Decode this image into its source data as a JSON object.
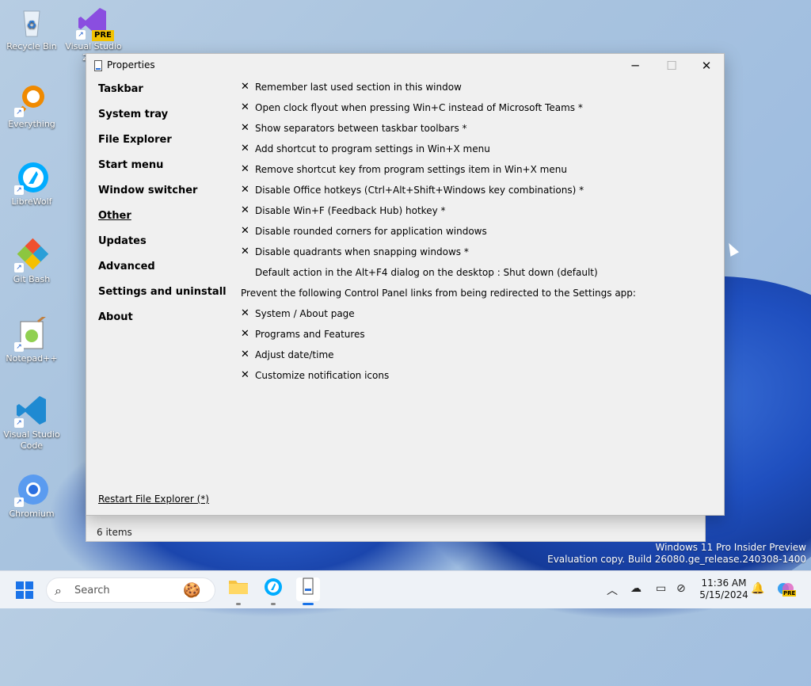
{
  "desktop": {
    "icons": [
      {
        "label": "Recycle Bin"
      },
      {
        "label": "Visual Studio 2022",
        "badge": "PRE"
      },
      {
        "label": "Everything"
      },
      {
        "label": "LibreWolf"
      },
      {
        "label": "Git Bash"
      },
      {
        "label": "Notepad++"
      },
      {
        "label": "Visual Studio Code"
      },
      {
        "label": "Chromium"
      }
    ],
    "watermark": {
      "line1": "Windows 11 Pro Insider Preview",
      "line2": "Evaluation copy. Build 26080.ge_release.240308-1400"
    }
  },
  "back_window": {
    "status": "6 items"
  },
  "window": {
    "title": "Properties",
    "nav": [
      {
        "label": "Taskbar"
      },
      {
        "label": "System tray"
      },
      {
        "label": "File Explorer"
      },
      {
        "label": "Start menu"
      },
      {
        "label": "Window switcher"
      },
      {
        "label": "Other",
        "active": true
      },
      {
        "label": "Updates"
      },
      {
        "label": "Advanced"
      },
      {
        "label": "Settings and uninstall"
      },
      {
        "label": "About"
      }
    ],
    "check_mark": "✕",
    "options": [
      {
        "label": "Remember last used section in this window",
        "checked": true
      },
      {
        "label": "Open clock flyout when pressing Win+C instead of Microsoft Teams *",
        "checked": true
      },
      {
        "label": "Show separators between taskbar toolbars *",
        "checked": true
      },
      {
        "label": "Add shortcut to program settings in Win+X menu",
        "checked": true
      },
      {
        "label": "Remove shortcut key from program settings item in Win+X menu",
        "checked": true
      },
      {
        "label": "Disable Office hotkeys (Ctrl+Alt+Shift+Windows key combinations) *",
        "checked": true
      },
      {
        "label": "Disable Win+F (Feedback Hub) hotkey *",
        "checked": true
      },
      {
        "label": "Disable rounded corners for application windows",
        "checked": true
      },
      {
        "label": "Disable quadrants when snapping windows *",
        "checked": true
      },
      {
        "label": "Default action in the Alt+F4 dialog on the desktop : Shut down (default)",
        "checked": false
      }
    ],
    "redirect_heading": "Prevent the following Control Panel links from being redirected to the Settings app:",
    "redirect_options": [
      {
        "label": "System / About page",
        "checked": true
      },
      {
        "label": "Programs and Features",
        "checked": true
      },
      {
        "label": "Adjust date/time",
        "checked": true
      },
      {
        "label": "Customize notification icons",
        "checked": true
      }
    ],
    "restart_link": "Restart File Explorer (*)"
  },
  "taskbar": {
    "search_placeholder": "Search",
    "clock_time": "11:36 AM",
    "clock_date": "5/15/2024",
    "copilot_badge": "PRE"
  }
}
